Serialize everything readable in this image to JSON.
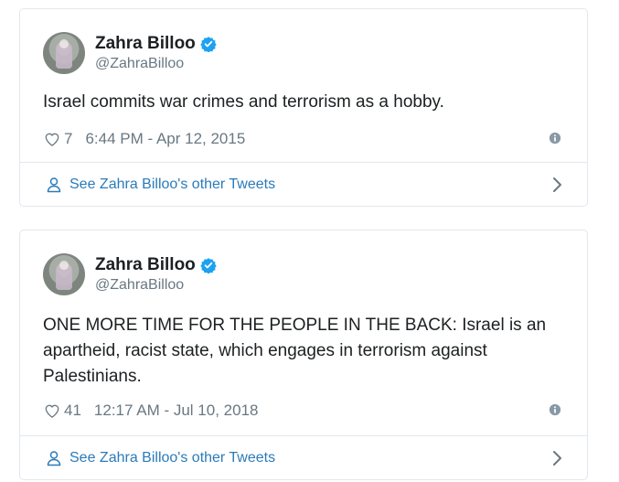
{
  "tweets": [
    {
      "display_name": "Zahra Billoo",
      "handle": "@ZahraBilloo",
      "text": "Israel commits war crimes and terrorism as a hobby.",
      "likes": "7",
      "timestamp": "6:44 PM - Apr 12, 2015",
      "footer_link": "See Zahra Billoo's other Tweets"
    },
    {
      "display_name": "Zahra Billoo",
      "handle": "@ZahraBilloo",
      "text": "ONE MORE TIME FOR THE PEOPLE IN THE BACK: Israel is an apartheid, racist state, which engages in terrorism against Palestinians.",
      "likes": "41",
      "timestamp": "12:17 AM - Jul 10, 2018",
      "footer_link": "See Zahra Billoo's other Tweets"
    }
  ],
  "icons": {
    "verified": "verified-badge-icon",
    "like": "heart-icon",
    "info": "info-icon",
    "profile": "person-icon",
    "chevron": "chevron-right-icon"
  },
  "colors": {
    "link": "#2b7bb9",
    "verified": "#1da1f2",
    "muted": "#697882",
    "border": "#e1e8ed"
  }
}
